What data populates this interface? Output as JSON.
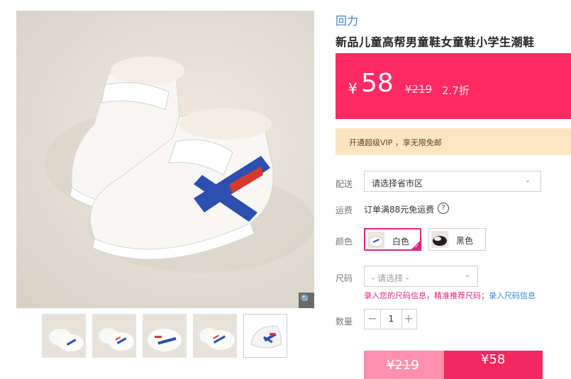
{
  "product": {
    "brand": "回力",
    "title": "新品儿童高帮男童鞋女童鞋小学生潮鞋"
  },
  "price": {
    "currency": "¥",
    "current": "58",
    "original": "¥219",
    "discount": "2.7折"
  },
  "promo": {
    "vip_text": "开通超级VIP ，享无限免邮"
  },
  "delivery": {
    "label": "配送",
    "select_value": "请选择省市区"
  },
  "shipping": {
    "label": "运费",
    "text": "订单满88元免运费",
    "help_icon": "question-circle-icon"
  },
  "color": {
    "label": "颜色",
    "options": [
      {
        "name": "白色",
        "selected": true
      },
      {
        "name": "黑色",
        "selected": false
      }
    ]
  },
  "size": {
    "label": "尺码",
    "placeholder": "- 请选择 -",
    "hint": "录入您的尺码信息，精准推荐尺码；",
    "hint_link": "录入尺码信息"
  },
  "quantity": {
    "label": "数量",
    "value": "1",
    "minus": "−",
    "plus": "+"
  },
  "buttons": {
    "original_price": "¥219",
    "buy_price": "¥58"
  },
  "icons": {
    "zoom": "magnifier-icon",
    "chevron": "chevron-down-icon"
  },
  "colors": {
    "accent": "#ff2a63",
    "brand_blue": "#3a84d4",
    "select_pink": "#e5227e",
    "vip_bg": "#fde5c3"
  }
}
